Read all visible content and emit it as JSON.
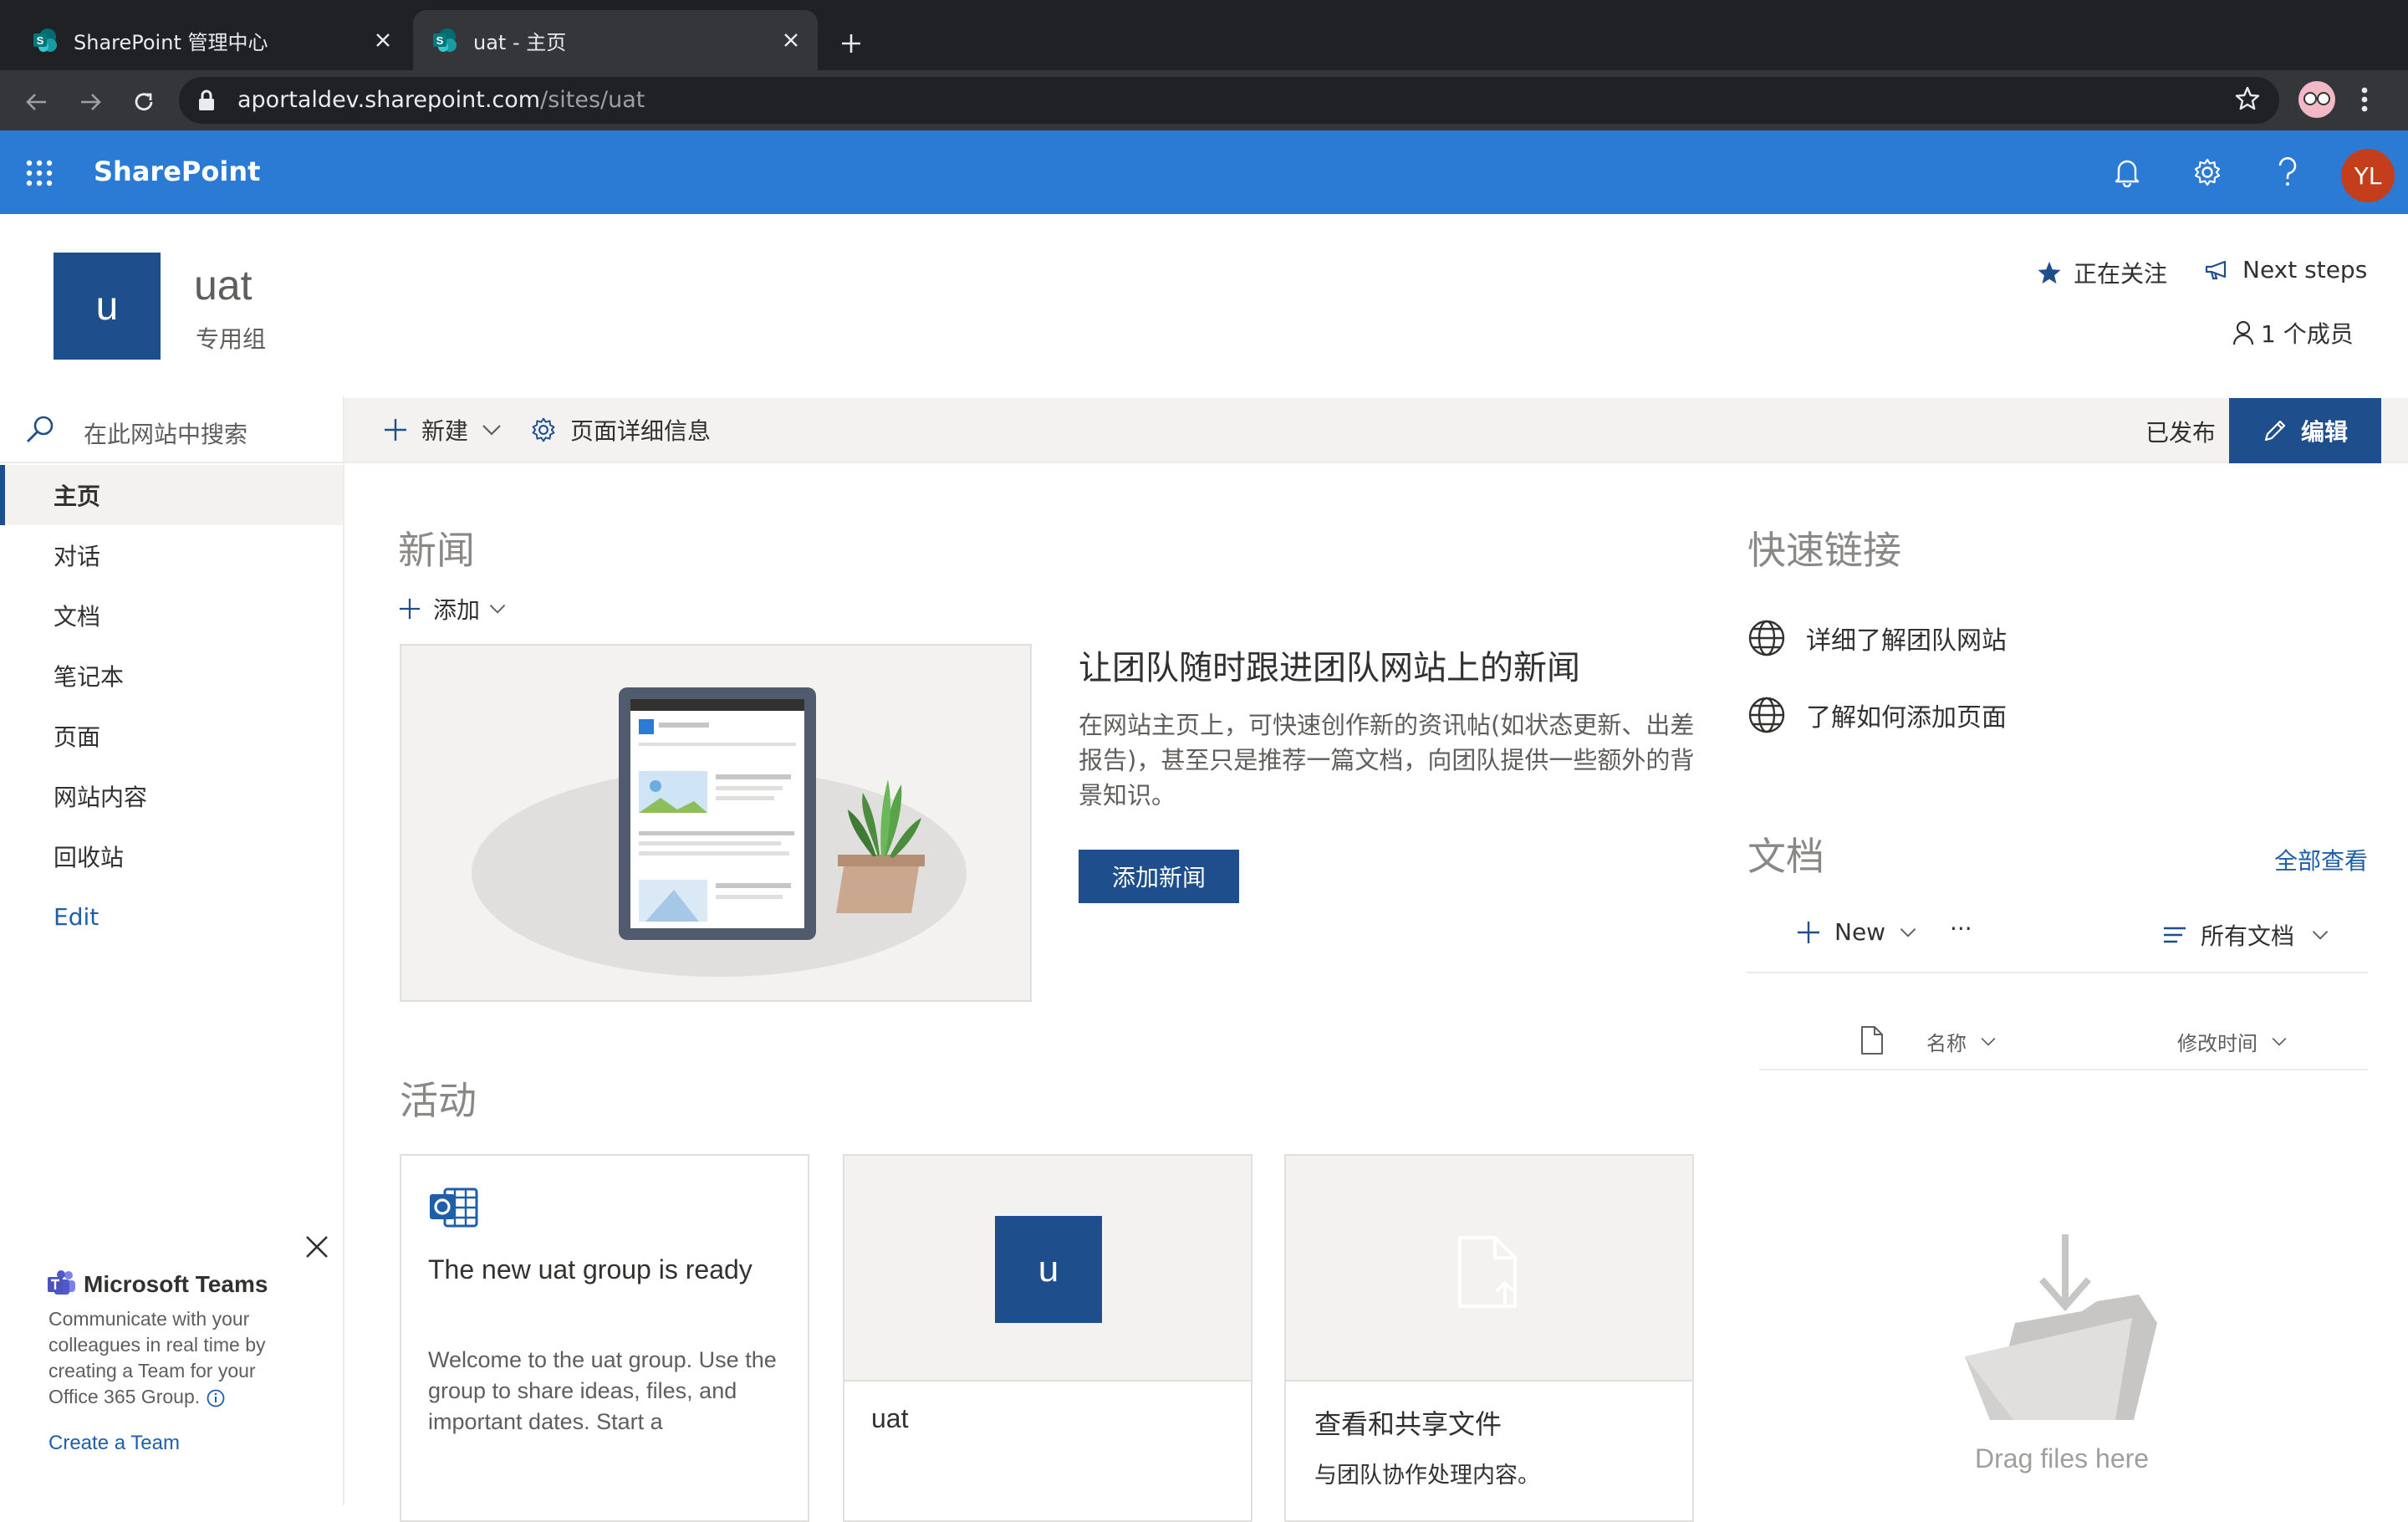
{
  "browser": {
    "tabs": [
      {
        "title": "SharePoint 管理中心",
        "active": false
      },
      {
        "title": "uat - 主页",
        "active": true
      }
    ],
    "url_host": "aportaldev.sharepoint.com",
    "url_path": "/sites/uat"
  },
  "suite": {
    "brand": "SharePoint",
    "avatar_initials": "YL",
    "color": "#2b7bd4"
  },
  "site": {
    "logo_letter": "u",
    "title": "uat",
    "subtitle": "专用组",
    "follow_label": "正在关注",
    "next_steps_label": "Next steps",
    "members_label": "1 个成员"
  },
  "search": {
    "placeholder": "在此网站中搜索"
  },
  "nav": {
    "items": [
      {
        "label": "主页",
        "selected": true
      },
      {
        "label": "对话"
      },
      {
        "label": "文档"
      },
      {
        "label": "笔记本"
      },
      {
        "label": "页面"
      },
      {
        "label": "网站内容"
      },
      {
        "label": "回收站"
      }
    ],
    "edit_label": "Edit"
  },
  "commandbar": {
    "new_label": "新建",
    "page_details_label": "页面详细信息",
    "published_label": "已发布",
    "edit_label": "编辑"
  },
  "news": {
    "title": "新闻",
    "add_label": "添加",
    "headline": "让团队随时跟进团队网站上的新闻",
    "body": "在网站主页上，可快速创作新的资讯帖(如状态更新、出差报告)，甚至只是推荐一篇文档，向团队提供一些额外的背景知识。",
    "add_news_button": "添加新闻"
  },
  "activity": {
    "title": "活动",
    "cards": [
      {
        "title": "The new uat group is ready",
        "body": "Welcome to the uat group. Use the group to share ideas, files, and important dates. Start a"
      },
      {
        "logo_letter": "u",
        "title": "uat"
      },
      {
        "title": "查看和共享文件",
        "body": "与团队协作处理内容。"
      }
    ]
  },
  "quicklinks": {
    "title": "快速链接",
    "items": [
      {
        "label": "详细了解团队网站"
      },
      {
        "label": "了解如何添加页面"
      }
    ]
  },
  "documents": {
    "title": "文档",
    "see_all": "全部查看",
    "new_label": "New",
    "more_label": "···",
    "view_label": "所有文档",
    "col_name": "名称",
    "col_modified": "修改时间",
    "empty_text": "Drag files here"
  },
  "teams_promo": {
    "title": "Microsoft Teams",
    "text": "Communicate with your colleagues in real time by creating a Team for your Office 365 Group.",
    "link": "Create a Team"
  }
}
